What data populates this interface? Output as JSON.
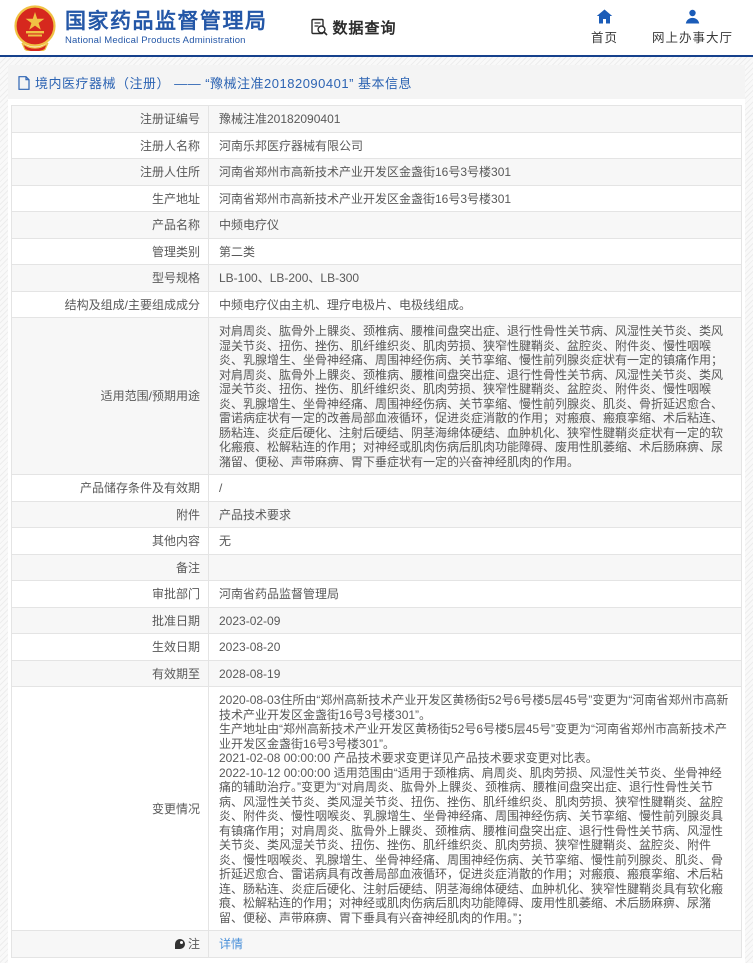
{
  "header": {
    "logo": {
      "title": "国家药品监督管理局",
      "subtitle": "National Medical Products Administration"
    },
    "data_query_label": "数据查询",
    "nav": [
      {
        "label": "首页",
        "icon": "home-icon"
      },
      {
        "label": "网上办事大厅",
        "icon": "user-icon"
      }
    ]
  },
  "page_title": "境内医疗器械（注册） —— “豫械注准20182090401” 基本信息",
  "colors": {
    "brand_blue": "#2457a7",
    "header_line_blue": "#16418c",
    "title_text_blue": "#2d64b3",
    "link_blue": "#4a90d9",
    "emblem_red": "#d6281e",
    "emblem_gold": "#f0c244",
    "zebra_gray": "#f7f7f7"
  },
  "table": {
    "rows": [
      {
        "label": "注册证编号",
        "value": "豫械注准20182090401"
      },
      {
        "label": "注册人名称",
        "value": "河南乐邦医疗器械有限公司"
      },
      {
        "label": "注册人住所",
        "value": "河南省郑州市高新技术产业开发区金盏街16号3号楼301"
      },
      {
        "label": "生产地址",
        "value": "河南省郑州市高新技术产业开发区金盏街16号3号楼301"
      },
      {
        "label": "产品名称",
        "value": "中频电疗仪"
      },
      {
        "label": "管理类别",
        "value": "第二类"
      },
      {
        "label": "型号规格",
        "value": "LB-100、LB-200、LB-300"
      },
      {
        "label": "结构及组成/主要组成成分",
        "value": "中频电疗仪由主机、理疗电极片、电极线组成。"
      },
      {
        "label": "适用范围/预期用途",
        "value": "对肩周炎、肱骨外上髁炎、颈椎病、腰椎间盘突出症、退行性骨性关节病、风湿性关节炎、类风湿关节炎、扭伤、挫伤、肌纤维织炎、肌肉劳损、狭窄性腱鞘炎、盆腔炎、附件炎、慢性咽喉炎、乳腺增生、坐骨神经痛、周围神经伤病、关节挛缩、慢性前列腺炎症状有一定的镇痛作用；对肩周炎、肱骨外上髁炎、颈椎病、腰椎间盘突出症、退行性骨性关节病、风湿性关节炎、类风湿关节炎、扭伤、挫伤、肌纤维织炎、肌肉劳损、狭窄性腱鞘炎、盆腔炎、附件炎、慢性咽喉炎、乳腺增生、坐骨神经痛、周围神经伤病、关节挛缩、慢性前列腺炎、肌炎、骨折延迟愈合、雷诺病症状有一定的改善局部血液循环，促进炎症消散的作用；对瘢痕、瘢痕挛缩、术后粘连、肠粘连、炎症后硬化、注射后硬结、阴茎海绵体硬结、血肿机化、狭窄性腱鞘炎症状有一定的软化瘢痕、松解粘连的作用；对神经或肌肉伤病后肌肉功能障碍、废用性肌萎缩、术后肠麻痹、尿潴留、便秘、声带麻痹、胃下垂症状有一定的兴奋神经肌肉的作用。"
      },
      {
        "label": "产品储存条件及有效期",
        "value": "/"
      },
      {
        "label": "附件",
        "value": "产品技术要求"
      },
      {
        "label": "其他内容",
        "value": "无"
      },
      {
        "label": "备注",
        "value": ""
      },
      {
        "label": "审批部门",
        "value": "河南省药品监督管理局"
      },
      {
        "label": "批准日期",
        "value": "2023-02-09"
      },
      {
        "label": "生效日期",
        "value": "2023-08-20"
      },
      {
        "label": "有效期至",
        "value": "2028-08-19"
      },
      {
        "label": "变更情况",
        "value": [
          "2020-08-03住所由“郑州高新技术产业开发区黄杨街52号6号楼5层45号”变更为“河南省郑州市高新技术产业开发区金盏街16号3号楼301”。",
          "生产地址由“郑州高新技术产业开发区黄杨街52号6号楼5层45号”变更为“河南省郑州市高新技术产业开发区金盏街16号3号楼301”。",
          "2021-02-08 00:00:00 产品技术要求变更详见产品技术要求变更对比表。",
          "2022-10-12 00:00:00 适用范围由“适用于颈椎病、肩周炎、肌肉劳损、风湿性关节炎、坐骨神经痛的辅助治疗。”变更为“对肩周炎、肱骨外上髁炎、颈椎病、腰椎间盘突出症、退行性骨性关节病、风湿性关节炎、类风湿关节炎、扭伤、挫伤、肌纤维织炎、肌肉劳损、狭窄性腱鞘炎、盆腔炎、附件炎、慢性咽喉炎、乳腺增生、坐骨神经痛、周围神经伤病、关节挛缩、慢性前列腺炎具有镇痛作用；对肩周炎、肱骨外上髁炎、颈椎病、腰椎间盘突出症、退行性骨性关节病、风湿性关节炎、类风湿关节炎、扭伤、挫伤、肌纤维织炎、肌肉劳损、狭窄性腱鞘炎、盆腔炎、附件炎、慢性咽喉炎、乳腺增生、坐骨神经痛、周围神经伤病、关节挛缩、慢性前列腺炎、肌炎、骨折延迟愈合、雷诺病具有改善局部血液循环，促进炎症消散的作用；对瘢痕、瘢痕挛缩、术后粘连、肠粘连、炎症后硬化、注射后硬结、阴茎海绵体硬结、血肿机化、狭窄性腱鞘炎具有软化瘢痕、松解粘连的作用；对神经或肌肉伤病后肌肉功能障碍、废用性肌萎缩、术后肠麻痹、尿潴留、便秘、声带麻痹、胃下垂具有兴奋神经肌肉的作用。”；"
        ]
      },
      {
        "label": "注",
        "icon": "note-icon",
        "link": true,
        "value": "详情"
      }
    ]
  }
}
